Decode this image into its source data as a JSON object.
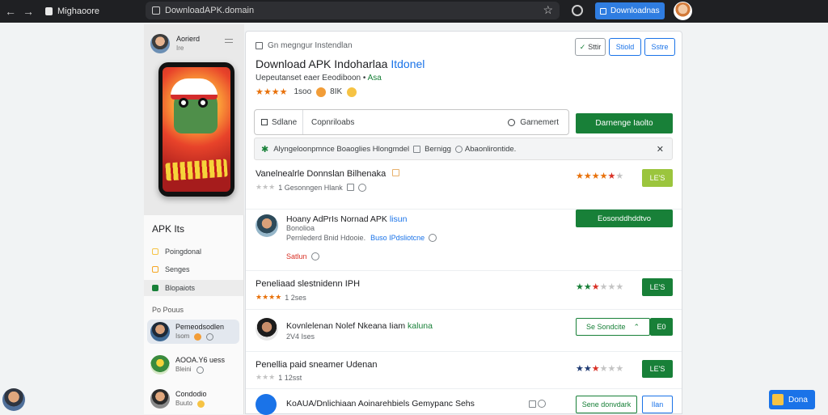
{
  "browser": {
    "site_name": "Mighaoore",
    "url": "DownloadAPK.domain",
    "cta_label": "Downloadnas",
    "colors": {
      "bar": "#1f2023",
      "cta": "#2f7de1"
    }
  },
  "sidebar": {
    "profile": {
      "name": "Aorierd",
      "sub": "Ire"
    },
    "section_title": "APK Its",
    "items": [
      {
        "label": "Poingdonal",
        "color": "#f6c344"
      },
      {
        "label": "Senges",
        "color": "#f5a623"
      },
      {
        "label": "Blopaiots",
        "color": "#188038"
      }
    ],
    "sub_heading": "Po Pouus",
    "users": [
      {
        "name": "Pemeodsodlen",
        "meta": "Isom"
      },
      {
        "name": "AOOA.Y6 uess",
        "meta": "Bleini"
      },
      {
        "name": "Condodio",
        "meta": "Buuto"
      }
    ]
  },
  "main": {
    "breadcrumb": "Gn megngur Instendlan",
    "header_buttons": [
      "Sttir",
      "Stiold",
      "Sstre"
    ],
    "title_main": "Download APK Indoharlaa ",
    "title_accent": "Itdonel",
    "subtitle_main": "Uepeutanset eaer Eeodiboon",
    "subtitle_tag": "Asa",
    "rating_stars": "★★★★",
    "rating_count": "1soo",
    "rating_extra": "8IK",
    "search": {
      "scope": "Sdlane",
      "placeholder": "Copnriloabs",
      "go_label": "Garnemert"
    },
    "download_label": "Darnenge Iaolto",
    "notice": {
      "text": "Alyngeloonpmnce Boaoglies Hlongmdel",
      "extra_1": "Bernigg",
      "extra_2": "Abaonlirontide.",
      "close": "✕"
    }
  },
  "rows": [
    {
      "name": "Vanelnealrle Donnslan Bilhenaka",
      "meta": "1 Gesonngen Hlank",
      "stars": "★★★★★",
      "action": "LE'S"
    },
    {
      "name": "Hoany AdPrIs Nornad APK",
      "name_tag": "lisun",
      "line2": "Bonolioa",
      "line3_a": "Pernlederd Bnid Hdooie.",
      "line3_b": "Buso IPdsliotcne",
      "line4": "Satlun",
      "action": "Eosonddhddtvo"
    },
    {
      "name": "Peneliaad slestnidenn IPH",
      "meta": "1 2ses",
      "stars": "★★★★★★",
      "action": "LE'S"
    },
    {
      "name": "Kovnlelenan Nolef Nkeana Iiam",
      "name_tag": "kaluna",
      "meta": "2V4 Ises",
      "action_secondary": "Se Sondcite",
      "action_arrow": "⌃",
      "action": "E0"
    },
    {
      "name": "Penellia paid sneamer Udenan",
      "meta": "1 12sst",
      "stars": "★★★★★★",
      "action": "LE'S"
    },
    {
      "name": "KoAUA/Dnlichiaan Aoinarehbiels Gemypanc Sehs",
      "action_secondary": "Sene donvdark",
      "action": "Ilan"
    }
  ],
  "float_button": "Dona",
  "colors": {
    "primary_green": "#188038",
    "accent_blue": "#1a73e8",
    "star_orange": "#e8710a"
  }
}
